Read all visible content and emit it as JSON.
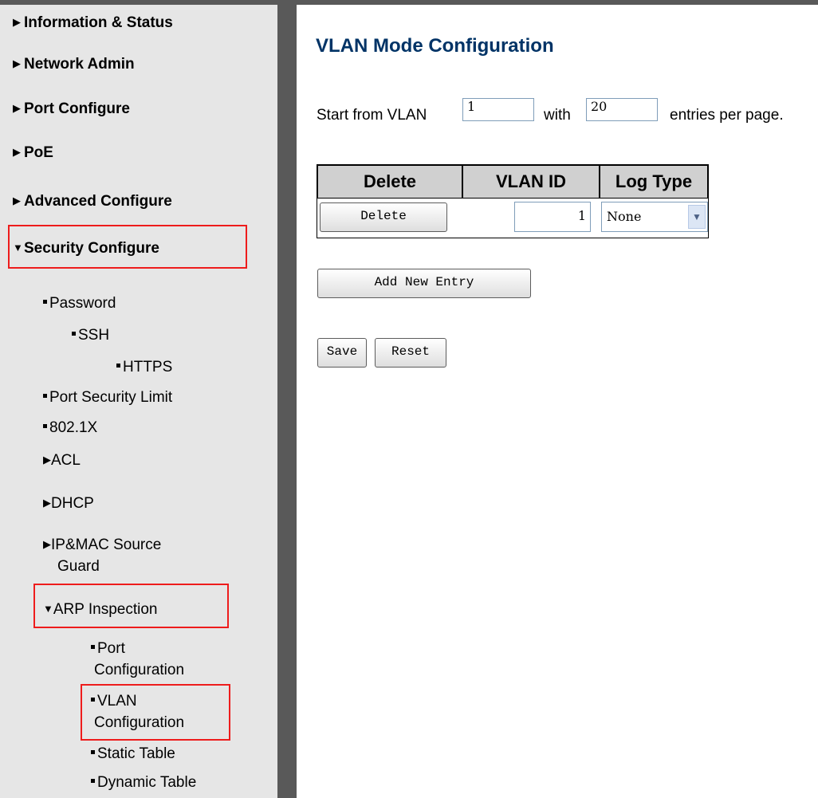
{
  "sidebar": {
    "items": [
      {
        "label": "Information & Status"
      },
      {
        "label": "Network Admin"
      },
      {
        "label": "Port Configure"
      },
      {
        "label": "PoE"
      },
      {
        "label": "Advanced Configure"
      },
      {
        "label": "Security Configure"
      }
    ],
    "security": {
      "password": "Password",
      "ssh": "SSH",
      "https": "HTTPS",
      "port_security_limit": "Port Security Limit",
      "dot1x": "802.1X",
      "acl": "ACL",
      "dhcp": "DHCP",
      "ipmac_line1": "IP&MAC Source",
      "ipmac_line2": "Guard",
      "arp_inspection": "ARP Inspection",
      "arp": {
        "port_line1": "Port",
        "port_line2": "Configuration",
        "vlan_line1": "VLAN",
        "vlan_line2": "Configuration",
        "static_table": "Static Table",
        "dynamic_table": "Dynamic Table"
      }
    }
  },
  "main": {
    "title": "VLAN Mode Configuration",
    "paging": {
      "start_label": "Start from VLAN",
      "start_value": "1",
      "with_label": "with",
      "entries_value": "20",
      "entries_label": "entries per page."
    },
    "table": {
      "headers": [
        "Delete",
        "VLAN ID",
        "Log Type"
      ],
      "rows": [
        {
          "delete_label": "Delete",
          "vlan_id": "1",
          "log_type": "None"
        }
      ]
    },
    "add_entry_label": "Add New Entry",
    "save_label": "Save",
    "reset_label": "Reset"
  },
  "colors": {
    "title": "#003366",
    "highlight_box": "#ee1c1c",
    "sidebar_bg": "#e6e6e6",
    "frame_bg": "#595959"
  }
}
